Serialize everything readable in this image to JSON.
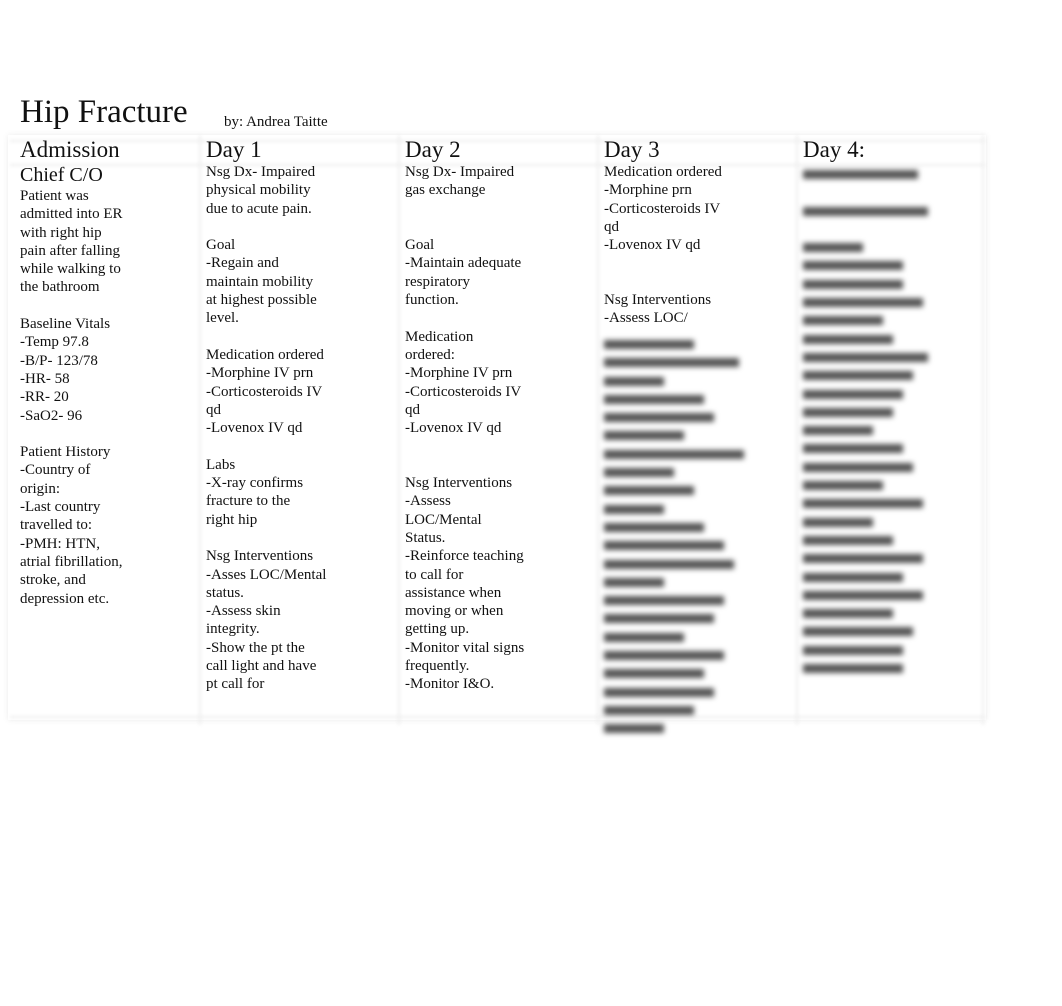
{
  "title": "Hip Fracture",
  "author": "by: Andrea Taitte",
  "columns": [
    {
      "header": "Admission",
      "subheader": "Chief C/O",
      "lines": [
        "Patient was",
        "admitted into ER",
        "with right hip",
        "pain after falling",
        "while walking to",
        "the bathroom",
        "",
        "Baseline Vitals",
        "-Temp 97.8",
        "-B/P- 123/78",
        "-HR- 58",
        "-RR- 20",
        "-SaO2- 96",
        "",
        "Patient History",
        "-Country of",
        "origin:",
        "-Last country",
        "travelled to:",
        "-PMH: HTN,",
        "atrial fibrillation,",
        "stroke, and",
        "depression etc."
      ]
    },
    {
      "header": "Day 1",
      "lines": [
        "Nsg Dx- Impaired",
        "physical mobility",
        "due to acute pain.",
        "",
        "Goal",
        "-Regain and",
        "maintain mobility",
        "at highest possible",
        "level.",
        "",
        "Medication ordered",
        "-Morphine IV prn",
        "-Corticosteroids IV",
        "qd",
        "-Lovenox IV qd",
        "",
        "Labs",
        "-X-ray confirms",
        "fracture to the",
        "right hip",
        "",
        "Nsg Interventions",
        "-Asses LOC/Mental",
        "status.",
        "-Assess skin",
        "integrity.",
        "-Show the pt the",
        "call light and have",
        "pt call for"
      ]
    },
    {
      "header": "Day 2",
      "lines": [
        "Nsg Dx- Impaired",
        "gas exchange",
        "",
        "",
        "Goal",
        "-Maintain adequate",
        "respiratory",
        "function.",
        "",
        "Medication",
        "ordered:",
        "-Morphine IV prn",
        "-Corticosteroids IV",
        "qd",
        "-Lovenox IV qd",
        "",
        "",
        "Nsg Interventions",
        "-Assess",
        "LOC/Mental",
        "Status.",
        "-Reinforce teaching",
        "to call for",
        "assistance when",
        "moving or when",
        "getting up.",
        "-Monitor vital signs",
        "frequently.",
        "-Monitor I&O."
      ]
    },
    {
      "header": "Day 3",
      "lines": [
        "Medication ordered",
        "-Morphine prn",
        "-Corticosteroids IV",
        "qd",
        "-Lovenox IV qd",
        "",
        "",
        "Nsg Interventions",
        "-Assess LOC/"
      ]
    },
    {
      "header": "Day 4:",
      "lines": []
    }
  ]
}
